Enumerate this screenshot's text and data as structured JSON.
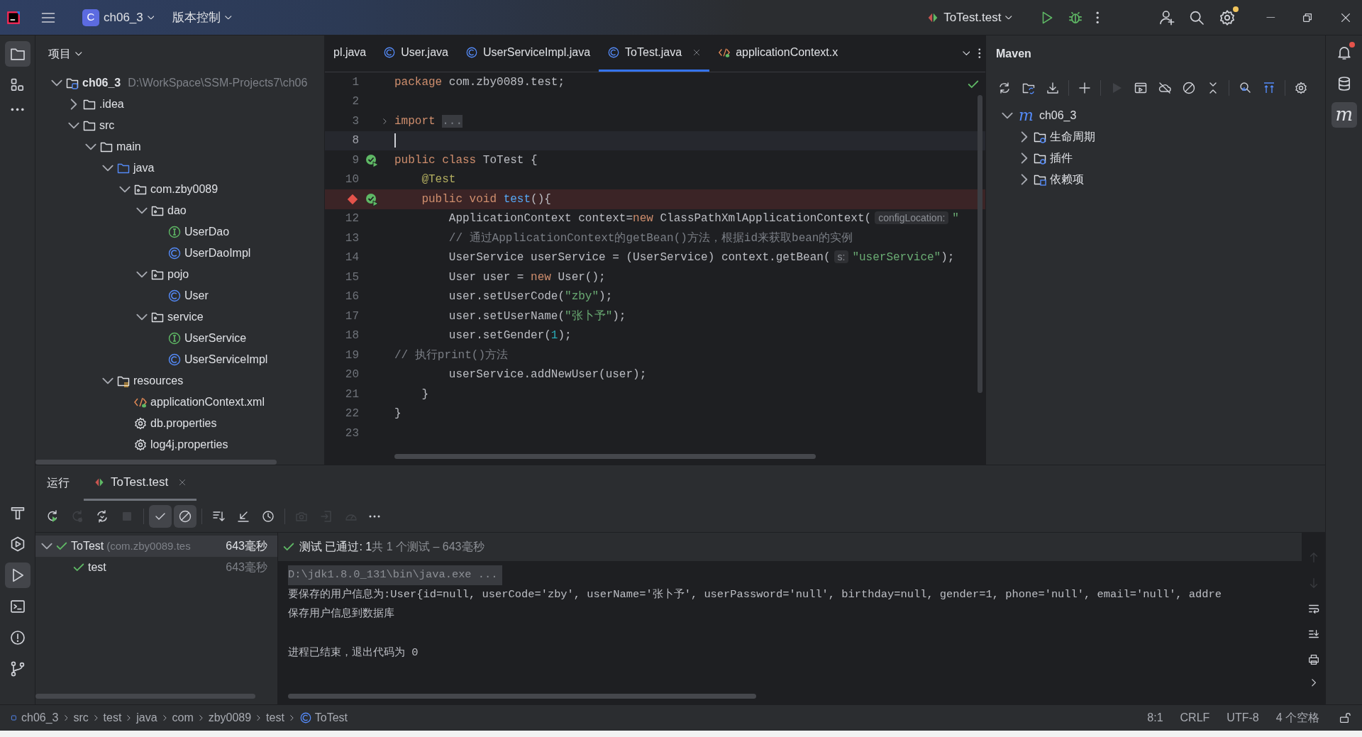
{
  "title_bar": {
    "project_badge": "C",
    "project": "ch06_3",
    "vcs": "版本控制",
    "run_config": "ToTest.test"
  },
  "left_toolbar": {
    "top": [
      {
        "kind": "folder",
        "selected": true
      },
      {
        "kind": "structure",
        "selected": false
      },
      {
        "kind": "more",
        "selected": false
      }
    ],
    "bottom": [
      {
        "kind": "hammer",
        "selected": false
      },
      {
        "kind": "services",
        "selected": false
      },
      {
        "kind": "run",
        "selected": true
      },
      {
        "kind": "terminal",
        "selected": false
      },
      {
        "kind": "problems",
        "selected": false
      },
      {
        "kind": "git",
        "selected": false
      }
    ]
  },
  "right_toolbar": [
    {
      "kind": "bell",
      "badge": true,
      "selected": false
    },
    {
      "kind": "database",
      "badge": false,
      "selected": false
    },
    {
      "kind": "glyph",
      "glyph": "m",
      "badge": false,
      "selected": true
    }
  ],
  "project_panel": {
    "title": "项目",
    "tree": [
      {
        "label": "ch06_3",
        "path": "D:\\WorkSpace\\SSM-Projects7\\ch06",
        "kind": "module",
        "expanded": true,
        "children": [
          {
            "label": ".idea",
            "kind": "folder",
            "expanded": false
          },
          {
            "label": "src",
            "kind": "folder",
            "expanded": true,
            "children": [
              {
                "label": "main",
                "kind": "folder",
                "expanded": true,
                "children": [
                  {
                    "label": "java",
                    "kind": "source",
                    "expanded": true,
                    "children": [
                      {
                        "label": "com.zby0089",
                        "kind": "package",
                        "expanded": true,
                        "children": [
                          {
                            "label": "dao",
                            "kind": "package",
                            "expanded": true,
                            "children": [
                              {
                                "label": "UserDao",
                                "kind": "interface"
                              },
                              {
                                "label": "UserDaoImpl",
                                "kind": "class"
                              }
                            ]
                          },
                          {
                            "label": "pojo",
                            "kind": "package",
                            "expanded": true,
                            "children": [
                              {
                                "label": "User",
                                "kind": "class"
                              }
                            ]
                          },
                          {
                            "label": "service",
                            "kind": "package",
                            "expanded": true,
                            "children": [
                              {
                                "label": "UserService",
                                "kind": "interface"
                              },
                              {
                                "label": "UserServiceImpl",
                                "kind": "class"
                              }
                            ]
                          }
                        ]
                      }
                    ]
                  },
                  {
                    "label": "resources",
                    "kind": "resources",
                    "expanded": true,
                    "children": [
                      {
                        "label": "applicationContext.xml",
                        "kind": "xml"
                      },
                      {
                        "label": "db.properties",
                        "kind": "gear"
                      },
                      {
                        "label": "log4j.properties",
                        "kind": "gear"
                      }
                    ]
                  }
                ]
              }
            ]
          }
        ]
      }
    ]
  },
  "editor": {
    "tabs": [
      {
        "label": "pl.java",
        "selected": false
      },
      {
        "label": "User.java",
        "kind": "class",
        "selected": false
      },
      {
        "label": "UserServiceImpl.java",
        "kind": "class",
        "selected": false
      },
      {
        "label": "ToTest.java",
        "kind": "class",
        "selected": true,
        "closable": true
      },
      {
        "label": "applicationContext.x",
        "kind": "xml",
        "selected": false
      }
    ],
    "lines": [
      {
        "number": "1",
        "kind": "plain",
        "current": false,
        "breakpoint": false,
        "tokens": [
          {
            "kind": "kw",
            "text": "package"
          },
          {
            "kind": "plain",
            "text": " com.zby0089.test;"
          }
        ]
      },
      {
        "number": "2",
        "kind": "plain",
        "current": false,
        "breakpoint": false
      },
      {
        "number": "3",
        "kind": "fold",
        "current": false,
        "breakpoint": false,
        "tokens": [
          {
            "kind": "kw",
            "text": "import "
          },
          {
            "kind": "folded",
            "text": "..."
          }
        ]
      },
      {
        "number": "8",
        "kind": "plain",
        "current": true,
        "breakpoint": false
      },
      {
        "number": "9",
        "kind": "run",
        "current": false,
        "breakpoint": false,
        "tokens": [
          {
            "kind": "kw",
            "text": "public class"
          },
          {
            "kind": "plain",
            "text": " ToTest {"
          }
        ]
      },
      {
        "number": "10",
        "kind": "plain",
        "current": false,
        "breakpoint": false,
        "tokens": [
          {
            "kind": "ann",
            "text": "    @Test"
          }
        ]
      },
      {
        "kind": "run",
        "current": false,
        "breakpoint": true,
        "tokens": [
          {
            "kind": "kw",
            "text": "    public void "
          },
          {
            "kind": "fn",
            "text": "test"
          },
          {
            "kind": "plain",
            "text": "(){"
          }
        ]
      },
      {
        "number": "12",
        "kind": "plain",
        "current": false,
        "breakpoint": false,
        "tokens": [
          {
            "kind": "plain",
            "text": "        ApplicationContext context="
          },
          {
            "kind": "kw",
            "text": "new"
          },
          {
            "kind": "plain",
            "text": " ClassPathXmlApplicationContext("
          },
          {
            "kind": "hint",
            "text": "configLocation:"
          },
          {
            "kind": "str",
            "text": "\""
          }
        ]
      },
      {
        "number": "13",
        "kind": "plain",
        "current": false,
        "breakpoint": false,
        "tokens": [
          {
            "kind": "cmt",
            "text": "        // 通过ApplicationContext的getBean()方法，根据id来获取bean的实例"
          }
        ]
      },
      {
        "number": "14",
        "kind": "plain",
        "current": false,
        "breakpoint": false,
        "tokens": [
          {
            "kind": "plain",
            "text": "        UserService userService = (UserService) context.getBean("
          },
          {
            "kind": "hint",
            "text": "s:"
          },
          {
            "kind": "str",
            "text": "\"userService\""
          },
          {
            "kind": "plain",
            "text": ");"
          }
        ]
      },
      {
        "number": "15",
        "kind": "plain",
        "current": false,
        "breakpoint": false,
        "tokens": [
          {
            "kind": "plain",
            "text": "        User user = "
          },
          {
            "kind": "kw",
            "text": "new"
          },
          {
            "kind": "plain",
            "text": " User();"
          }
        ]
      },
      {
        "number": "16",
        "kind": "plain",
        "current": false,
        "breakpoint": false,
        "tokens": [
          {
            "kind": "plain",
            "text": "        user.setUserCode("
          },
          {
            "kind": "str",
            "text": "\"zby\""
          },
          {
            "kind": "plain",
            "text": ");"
          }
        ]
      },
      {
        "number": "17",
        "kind": "plain",
        "current": false,
        "breakpoint": false,
        "tokens": [
          {
            "kind": "plain",
            "text": "        user.setUserName("
          },
          {
            "kind": "str",
            "text": "\"张卜予\""
          },
          {
            "kind": "plain",
            "text": ");"
          }
        ]
      },
      {
        "number": "18",
        "kind": "plain",
        "current": false,
        "breakpoint": false,
        "tokens": [
          {
            "kind": "plain",
            "text": "        user.setGender("
          },
          {
            "kind": "num",
            "text": "1"
          },
          {
            "kind": "plain",
            "text": ");"
          }
        ]
      },
      {
        "number": "19",
        "kind": "plain",
        "current": false,
        "breakpoint": false,
        "tokens": [
          {
            "kind": "cmt",
            "text": "// 执行print()方法"
          }
        ]
      },
      {
        "number": "20",
        "kind": "plain",
        "current": false,
        "breakpoint": false,
        "tokens": [
          {
            "kind": "plain",
            "text": "        userService.addNewUser(user);"
          }
        ]
      },
      {
        "number": "21",
        "kind": "plain",
        "current": false,
        "breakpoint": false,
        "tokens": [
          {
            "kind": "plain",
            "text": "    }"
          }
        ]
      },
      {
        "number": "22",
        "kind": "plain",
        "current": false,
        "breakpoint": false,
        "tokens": [
          {
            "kind": "plain",
            "text": "}"
          }
        ]
      },
      {
        "number": "23",
        "kind": "plain",
        "current": false,
        "breakpoint": false
      }
    ]
  },
  "maven_panel": {
    "title": "Maven",
    "toolbar": [
      {
        "kind": "reload",
        "disabled": false
      },
      {
        "kind": "folder-sync",
        "disabled": false
      },
      {
        "kind": "download",
        "disabled": false
      },
      {
        "kind": "sep"
      },
      {
        "kind": "plus",
        "disabled": false
      },
      {
        "kind": "sep"
      },
      {
        "kind": "play",
        "disabled": true
      },
      {
        "kind": "window",
        "disabled": false
      },
      {
        "kind": "cloud-off",
        "disabled": false
      },
      {
        "kind": "no",
        "disabled": false
      },
      {
        "kind": "collapse",
        "disabled": false
      },
      {
        "kind": "sep"
      },
      {
        "kind": "analyze",
        "disabled": false
      },
      {
        "kind": "align",
        "disabled": false
      },
      {
        "kind": "sep"
      },
      {
        "kind": "gear",
        "disabled": false
      }
    ],
    "tree": [
      {
        "label": "ch06_3",
        "glyph": "m",
        "expanded": true,
        "children": [
          {
            "label": "生命周期",
            "kind": "maven-folder",
            "expanded": false
          },
          {
            "label": "插件",
            "kind": "maven-folder",
            "expanded": false
          },
          {
            "label": "依赖项",
            "kind": "deps-folder",
            "expanded": false
          }
        ]
      }
    ]
  },
  "run_panel": {
    "title": "运行",
    "tabs": [
      {
        "label": "ToTest.test",
        "selected": true
      }
    ],
    "toolbar": [
      {
        "kind": "rerun",
        "disabled": false,
        "selected": false
      },
      {
        "kind": "rerun-failed",
        "disabled": true,
        "selected": false
      },
      {
        "kind": "toggle",
        "disabled": false,
        "selected": false
      },
      {
        "kind": "stop",
        "disabled": true,
        "selected": false
      },
      {
        "kind": "sep"
      },
      {
        "kind": "check",
        "disabled": false,
        "selected": true
      },
      {
        "kind": "no",
        "disabled": false,
        "selected": true
      },
      {
        "kind": "sep"
      },
      {
        "kind": "sort",
        "disabled": false,
        "selected": false
      },
      {
        "kind": "import",
        "disabled": false,
        "selected": false
      },
      {
        "kind": "clock",
        "disabled": false,
        "selected": false
      },
      {
        "kind": "sep"
      },
      {
        "kind": "camera",
        "disabled": true,
        "selected": false
      },
      {
        "kind": "export",
        "disabled": true,
        "selected": false
      },
      {
        "kind": "gauge",
        "disabled": true,
        "selected": false
      },
      {
        "kind": "more",
        "disabled": false,
        "selected": false
      }
    ],
    "tests": [
      {
        "label": "ToTest",
        "detail": "(com.zby0089.tes",
        "time": "643毫秒",
        "expanded": true,
        "selected": true,
        "children": [
          {
            "label": "test",
            "time": "643毫秒",
            "selected": false
          }
        ]
      }
    ],
    "result": {
      "summary": "测试 已通过: 1",
      "detail": "共 1 个测试 – 643毫秒"
    },
    "console": [
      {
        "kind": "command",
        "text": "D:\\jdk1.8.0_131\\bin\\java.exe ..."
      },
      {
        "kind": "output",
        "text": "要保存的用户信息为:User{id=null, userCode='zby', userName='张卜予', userPassword='null', birthday=null, gender=1, phone='null', email='null', addre"
      },
      {
        "kind": "output",
        "text": "保存用户信息到数据库"
      },
      {
        "kind": "exit",
        "text": "进程已结束，退出代码为 0"
      }
    ],
    "side_tools": [
      {
        "kind": "up",
        "disabled": true
      },
      {
        "kind": "down",
        "disabled": true
      },
      {
        "kind": "wrap",
        "disabled": false
      },
      {
        "kind": "scroll-end",
        "disabled": false
      },
      {
        "kind": "print",
        "disabled": false
      },
      {
        "kind": "chevron",
        "disabled": false
      }
    ]
  },
  "status_bar": {
    "breadcrumbs": [
      {
        "label": "ch06_3",
        "kind": "module-dot"
      },
      {
        "label": "src"
      },
      {
        "label": "test"
      },
      {
        "label": "java"
      },
      {
        "label": "com"
      },
      {
        "label": "zby0089"
      },
      {
        "label": "test"
      },
      {
        "label": "ToTest",
        "kind": "class"
      }
    ],
    "items": [
      "8:1",
      "CRLF",
      "UTF-8",
      "4 个空格"
    ],
    "locked": false
  }
}
